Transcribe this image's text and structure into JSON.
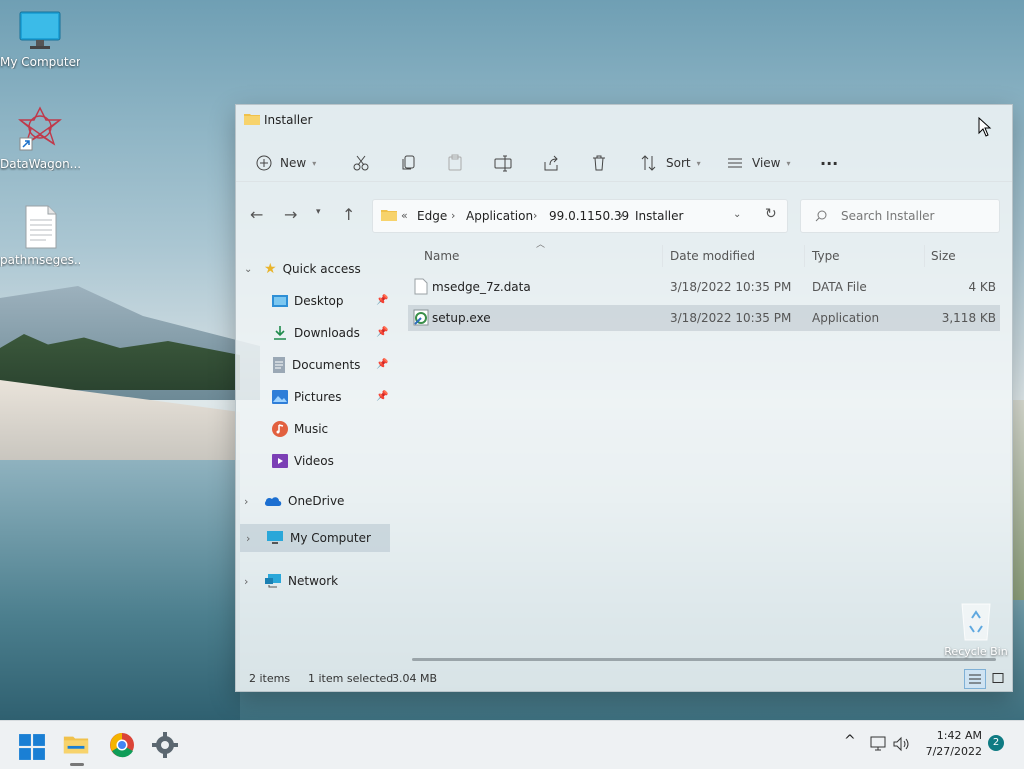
{
  "desktop": {
    "icons": [
      {
        "label": "My Computer",
        "icon": "monitor-icon"
      },
      {
        "label": "DataWagon...",
        "icon": "datawagon-app-icon"
      },
      {
        "label": "pathmseges...",
        "icon": "document-icon"
      }
    ],
    "recycle_bin": "Recycle Bin"
  },
  "window": {
    "title": "Installer",
    "toolbar": {
      "new_label": "New",
      "sort_label": "Sort",
      "view_label": "View",
      "more_label": "···",
      "icons": [
        "new-icon",
        "cut-icon",
        "copy-icon",
        "paste-icon",
        "rename-icon",
        "share-icon",
        "delete-icon",
        "sort-icon",
        "view-icon",
        "more-icon"
      ]
    },
    "address": {
      "overflow": "«",
      "crumbs": [
        "Edge",
        "Application",
        "99.0.1150.39",
        "Installer"
      ]
    },
    "search": {
      "placeholder": "Search Installer"
    },
    "sidebar": {
      "quick_access": "Quick access",
      "items": [
        {
          "label": "Desktop",
          "icon": "desktop-folder-icon",
          "pinned": true
        },
        {
          "label": "Downloads",
          "icon": "downloads-icon",
          "pinned": true
        },
        {
          "label": "Documents",
          "icon": "documents-icon",
          "pinned": true
        },
        {
          "label": "Pictures",
          "icon": "pictures-icon",
          "pinned": true
        },
        {
          "label": "Music",
          "icon": "music-icon",
          "pinned": false
        },
        {
          "label": "Videos",
          "icon": "videos-icon",
          "pinned": false
        }
      ],
      "onedrive": "OneDrive",
      "my_computer": "My Computer",
      "network": "Network"
    },
    "columns": {
      "name": "Name",
      "date": "Date modified",
      "type": "Type",
      "size": "Size"
    },
    "files": [
      {
        "name": "msedge_7z.data",
        "date": "3/18/2022 10:35 PM",
        "type": "DATA File",
        "size": "4 KB",
        "selected": false
      },
      {
        "name": "setup.exe",
        "date": "3/18/2022 10:35 PM",
        "type": "Application",
        "size": "3,118 KB",
        "selected": true
      }
    ],
    "status": {
      "items": "2 items",
      "selected": "1 item selected",
      "size": "3.04 MB"
    }
  },
  "taskbar": {
    "clock_time": "1:42 AM",
    "clock_date": "7/27/2022",
    "notification_count": "2",
    "tray_chevron": "^"
  },
  "colors": {
    "accent": "#0f7b83",
    "folder": "#f0c14b",
    "start_blue": "#1a7fd4"
  }
}
